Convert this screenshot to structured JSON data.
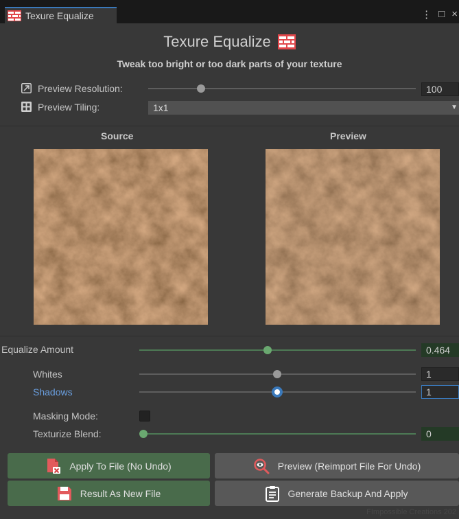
{
  "tab": {
    "title": "Texure Equalize"
  },
  "window_controls": {
    "more": "⋮",
    "maximize": "□",
    "close": "×"
  },
  "header": {
    "title": "Texure Equalize",
    "subtitle": "Tweak too bright or too dark parts of your texture"
  },
  "preview_resolution": {
    "label": "Preview Resolution:",
    "value": "100",
    "slider_fraction": 0.19
  },
  "preview_tiling": {
    "label": "Preview Tiling:",
    "value": "1x1"
  },
  "panels": {
    "source_label": "Source",
    "preview_label": "Preview"
  },
  "equalize_amount": {
    "label": "Equalize Amount",
    "value": "0.464",
    "slider_fraction": 0.464
  },
  "whites": {
    "label": "Whites",
    "value": "1",
    "slider_fraction": 0.5
  },
  "shadows": {
    "label": "Shadows",
    "value": "1",
    "slider_fraction": 0.5
  },
  "masking_mode": {
    "label": "Masking Mode:",
    "checked": false
  },
  "texturize_blend": {
    "label": "Texturize Blend:",
    "value": "0",
    "slider_fraction": 0.0
  },
  "buttons": {
    "apply_to_file": "Apply To File (No Undo)",
    "preview_reimport": "Preview (Reimport File For Undo)",
    "result_as_new_file": "Result As New File",
    "generate_backup": "Generate Backup And Apply"
  },
  "footer": {
    "credit": "FImpossible Creations 202"
  },
  "colors": {
    "accent_blue": "#3a79bb",
    "green_track": "#4d7a55",
    "green_button": "#496b4b"
  },
  "icons": [
    "texture-tool-icon",
    "resolution-icon",
    "tiling-grid-icon",
    "apply-file-icon",
    "magnifier-icon",
    "save-file-icon",
    "clipboard-icon"
  ]
}
